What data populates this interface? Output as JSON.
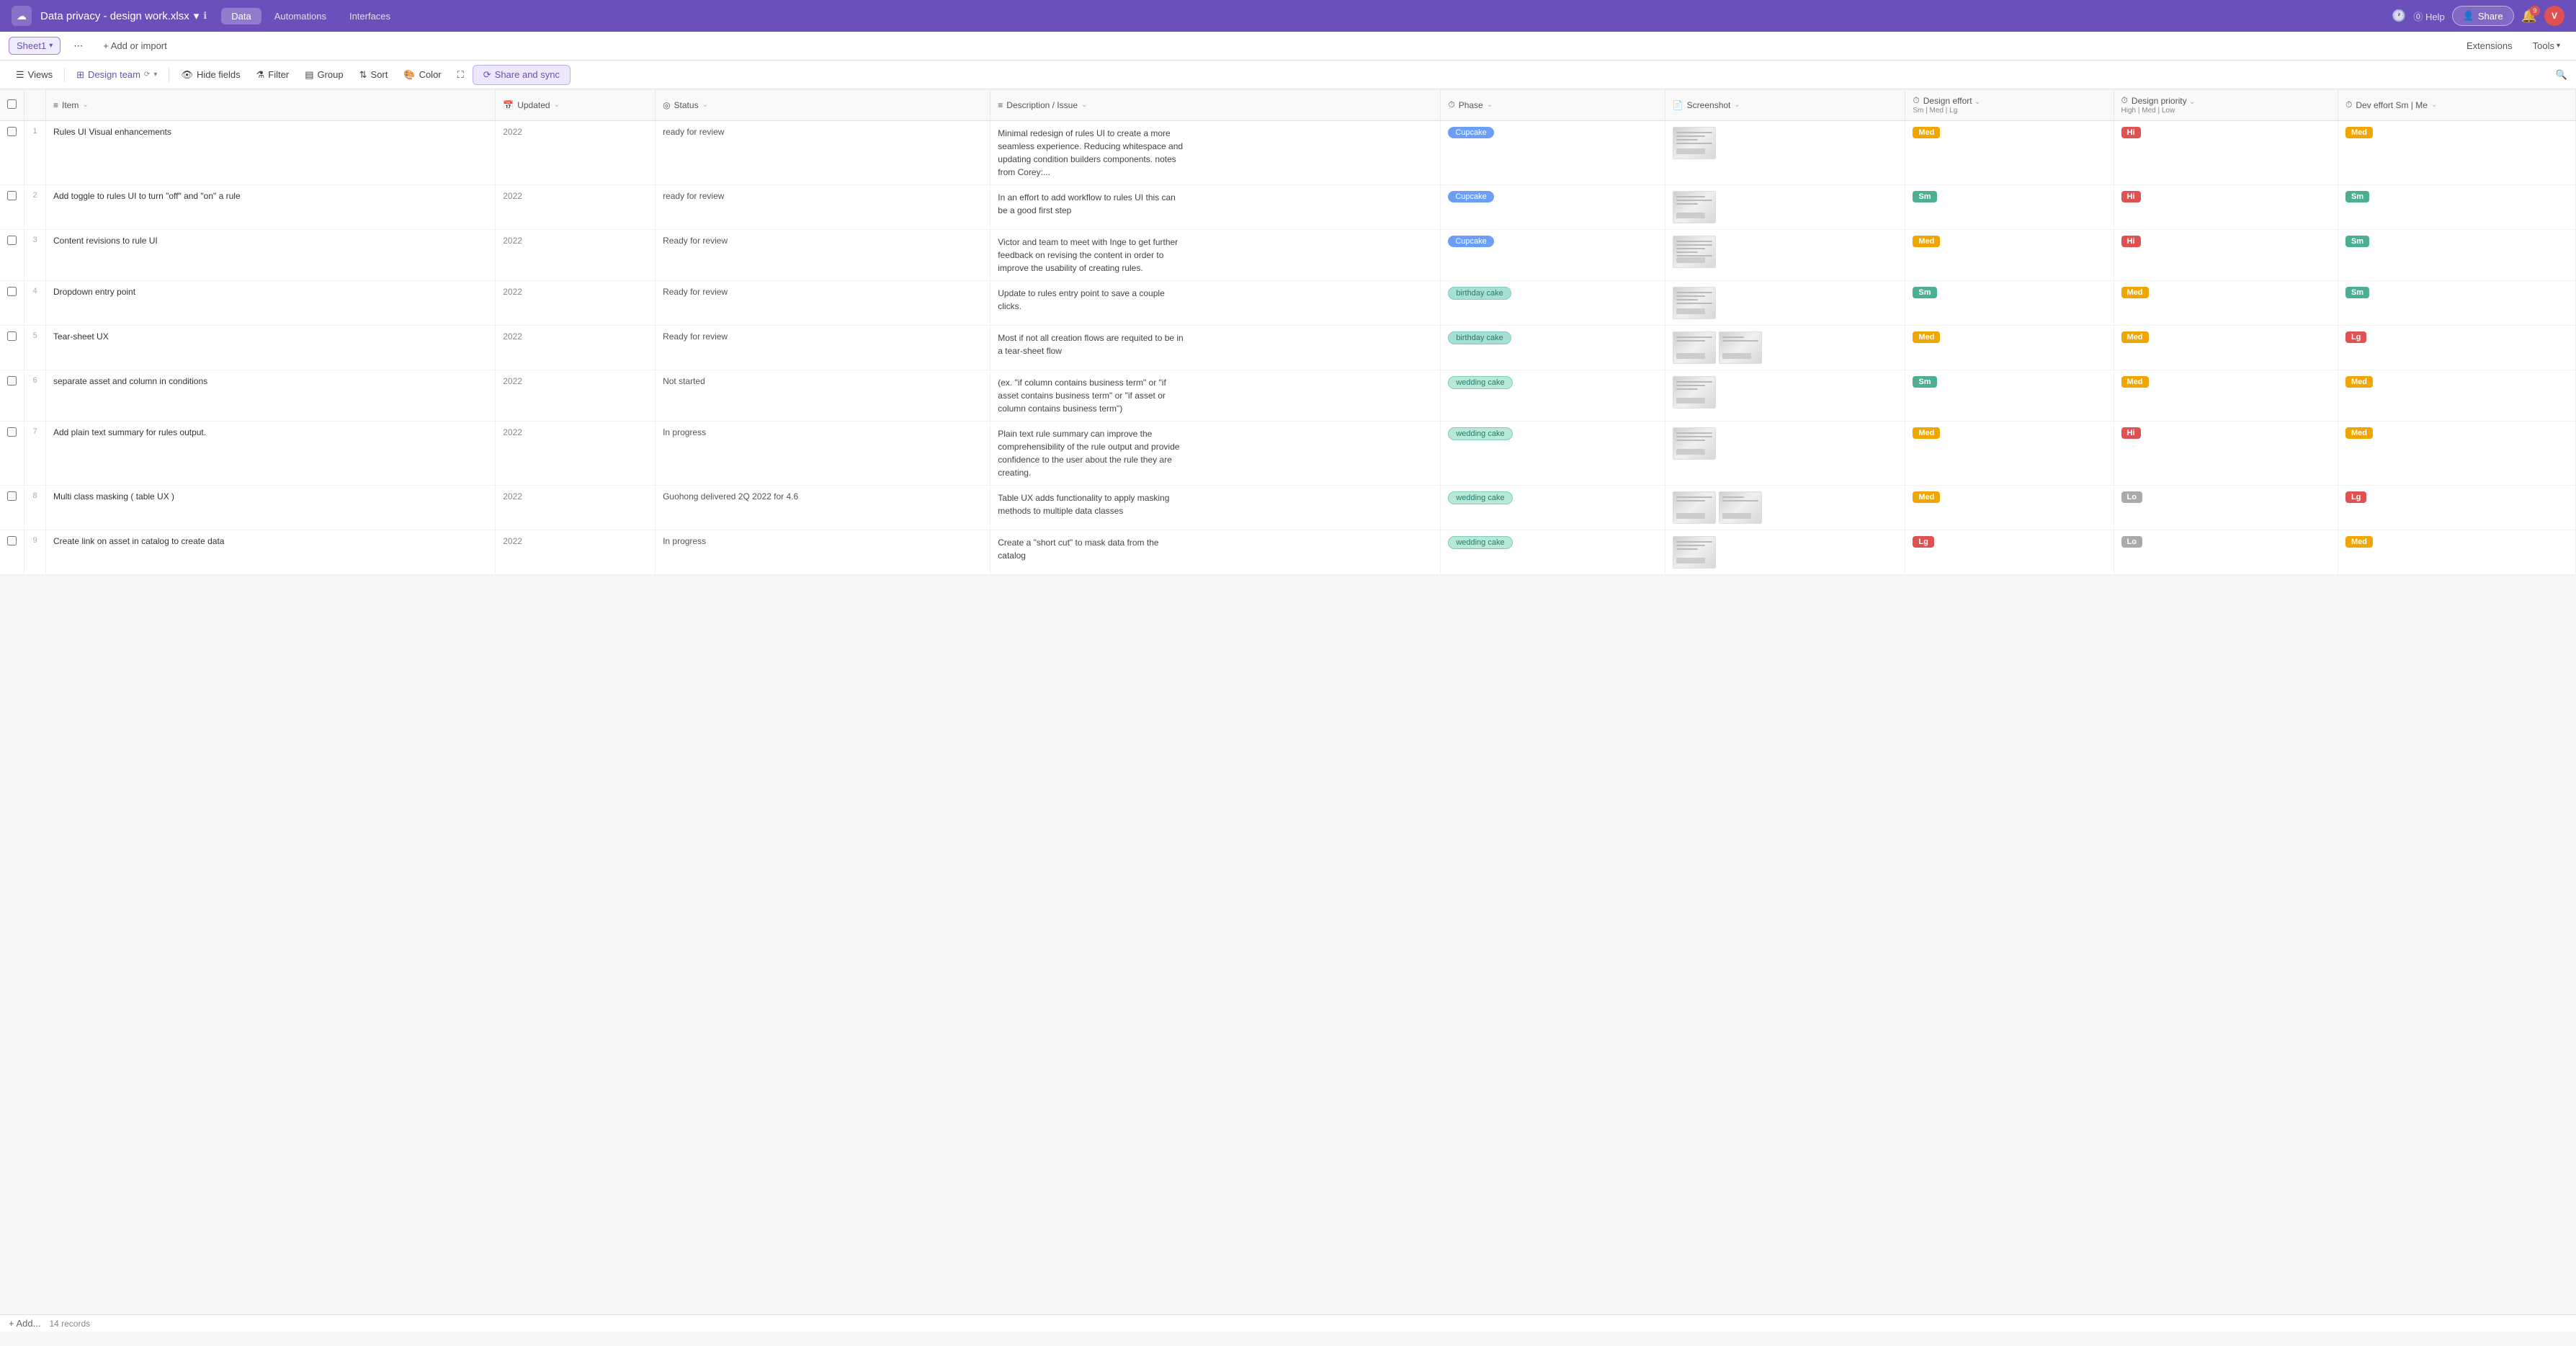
{
  "app": {
    "logo": "☁",
    "title": "Data privacy - design work.xlsx",
    "title_chevron": "▾",
    "info_icon": "ℹ",
    "nav_tabs": [
      {
        "label": "Data",
        "active": true
      },
      {
        "label": "Automations",
        "active": false
      },
      {
        "label": "Interfaces",
        "active": false
      }
    ],
    "nav_right": {
      "history_icon": "🕐",
      "help_label": "Help",
      "share_label": "Share",
      "bell_badge": "9",
      "avatar_label": "V"
    }
  },
  "sheet_bar": {
    "tab_label": "Sheet1",
    "tab_chevron": "▾",
    "more_icon": "⋯",
    "add_label": "+ Add or import",
    "extensions_label": "Extensions",
    "tools_label": "Tools"
  },
  "toolbar": {
    "views_label": "Views",
    "design_team_label": "Design team",
    "hide_fields_label": "Hide fields",
    "filter_label": "Filter",
    "group_label": "Group",
    "sort_label": "Sort",
    "color_label": "Color",
    "share_sync_label": "Share and sync",
    "search_icon": "🔍"
  },
  "columns": [
    {
      "id": "checkbox",
      "label": ""
    },
    {
      "id": "row_num",
      "label": ""
    },
    {
      "id": "item",
      "label": "Item",
      "icon": "≡"
    },
    {
      "id": "updated",
      "label": "Updated",
      "icon": "📅"
    },
    {
      "id": "status",
      "label": "Status",
      "icon": "◎"
    },
    {
      "id": "description",
      "label": "Description / Issue",
      "icon": "≡"
    },
    {
      "id": "phase",
      "label": "Phase",
      "icon": "⏱"
    },
    {
      "id": "screenshot",
      "label": "Screenshot",
      "icon": "📄"
    },
    {
      "id": "design_effort",
      "label": "Design effort",
      "sub": "Sm | Med | Lg",
      "icon": "⏱"
    },
    {
      "id": "design_priority",
      "label": "Design priority",
      "sub": "High | Med | Low",
      "icon": "⏱"
    },
    {
      "id": "dev_effort",
      "label": "Dev effort Sm | Me",
      "icon": "⏱"
    }
  ],
  "rows": [
    {
      "num": 1,
      "item": "Rules UI Visual enhancements",
      "updated": "2022",
      "status": "ready for review",
      "description": "Minimal redesign of rules UI to create a more seamless experience. Reducing whitespace and updating condition builders components. notes from Corey:...",
      "phase": "Cupcake",
      "phase_style": "cupcake",
      "design_effort": "Med",
      "design_effort_style": "med",
      "design_priority": "Hi",
      "design_priority_style": "hi",
      "dev_effort": "Med",
      "dev_effort_style": "med"
    },
    {
      "num": 2,
      "item": "Add toggle to rules UI to turn \"off\" and \"on\" a rule",
      "updated": "2022",
      "status": "ready for review",
      "description": "In an effort to add workflow to rules UI this can be a good first step",
      "phase": "Cupcake",
      "phase_style": "cupcake",
      "design_effort": "Sm",
      "design_effort_style": "sm",
      "design_priority": "Hi",
      "design_priority_style": "hi",
      "dev_effort": "Sm",
      "dev_effort_style": "sm"
    },
    {
      "num": 3,
      "item": "Content revisions to rule UI",
      "updated": "2022",
      "status": "Ready for review",
      "description": "Victor and team to meet with Inge to get further feedback on revising the content in order to improve the usability of creating rules.",
      "phase": "Cupcake",
      "phase_style": "cupcake",
      "design_effort": "Med",
      "design_effort_style": "med",
      "design_priority": "Hi",
      "design_priority_style": "hi",
      "dev_effort": "Sm",
      "dev_effort_style": "sm"
    },
    {
      "num": 4,
      "item": "Dropdown entry point",
      "updated": "2022",
      "status": "Ready for review",
      "description": "Update to rules entry point to save a couple clicks.",
      "phase": "birthday cake",
      "phase_style": "birthday",
      "design_effort": "Sm",
      "design_effort_style": "sm",
      "design_priority": "Med",
      "design_priority_style": "med",
      "dev_effort": "Sm",
      "dev_effort_style": "sm"
    },
    {
      "num": 5,
      "item": "Tear-sheet UX",
      "updated": "2022",
      "status": "Ready for review",
      "description": "Most if not all creation flows are requited to be in a tear-sheet flow",
      "phase": "birthday cake",
      "phase_style": "birthday",
      "design_effort": "Med",
      "design_effort_style": "med",
      "design_priority": "Med",
      "design_priority_style": "med",
      "dev_effort": "Lg",
      "dev_effort_style": "lg"
    },
    {
      "num": 6,
      "item": "separate asset and column in conditions",
      "updated": "2022",
      "status": "Not started",
      "description": "(ex. \"if column contains business term\" or \"if asset contains business term\" or \"if asset or column contains business term\")",
      "phase": "wedding cake",
      "phase_style": "wedding",
      "design_effort": "Sm",
      "design_effort_style": "sm",
      "design_priority": "Med",
      "design_priority_style": "med",
      "dev_effort": "Med",
      "dev_effort_style": "med"
    },
    {
      "num": 7,
      "item": "Add plain text summary for rules output.",
      "updated": "2022",
      "status": "In progress",
      "description": "Plain text rule summary can improve the comprehensibility of the rule output and provide confidence to the user about the rule they are creating.",
      "phase": "wedding cake",
      "phase_style": "wedding",
      "design_effort": "Med",
      "design_effort_style": "med",
      "design_priority": "Hi",
      "design_priority_style": "hi",
      "dev_effort": "Med",
      "dev_effort_style": "med"
    },
    {
      "num": 8,
      "item": "Multi class masking ( table UX )",
      "updated": "2022",
      "status": "Guohong delivered 2Q 2022 for 4.6",
      "description": "Table UX adds functionality to apply masking methods to multiple data classes",
      "phase": "wedding cake",
      "phase_style": "wedding",
      "design_effort": "Med",
      "design_effort_style": "med",
      "design_priority": "Lo",
      "design_priority_style": "lo",
      "dev_effort": "Lg",
      "dev_effort_style": "lg"
    },
    {
      "num": 9,
      "item": "Create link on asset in catalog to create data",
      "updated": "2022",
      "status": "In progress",
      "description": "Create a \"short cut\" to mask data from the catalog",
      "phase": "wedding cake",
      "phase_style": "wedding",
      "design_effort": "Lg",
      "design_effort_style": "lg",
      "design_priority": "Lo",
      "design_priority_style": "lo",
      "dev_effort": "Med",
      "dev_effort_style": "med"
    }
  ],
  "footer": {
    "add_label": "+ Add...",
    "records_label": "14 records"
  }
}
